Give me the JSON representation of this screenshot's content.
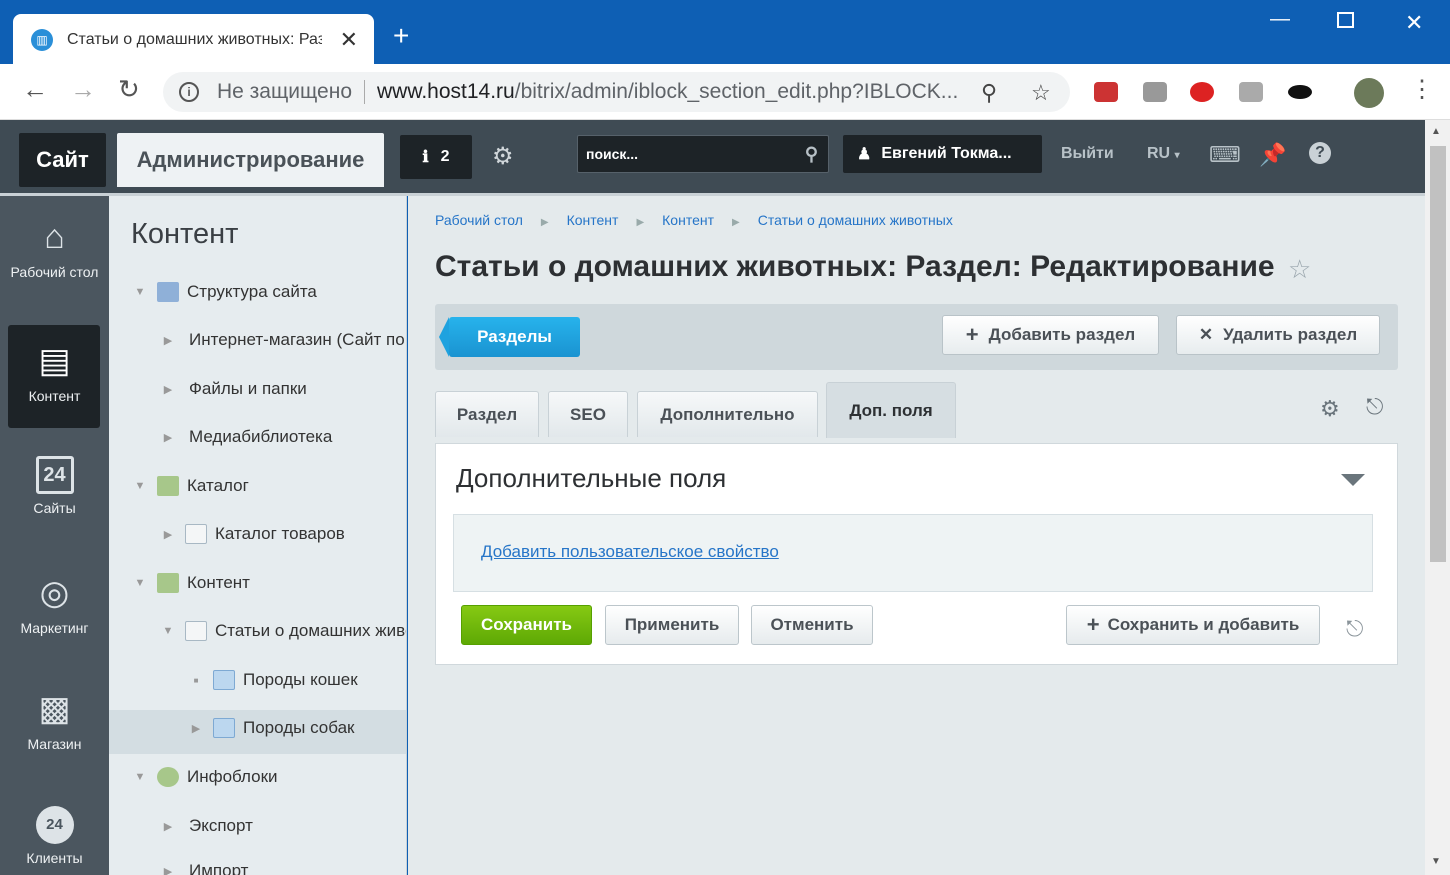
{
  "browser": {
    "tab_title": "Статьи о домашних животных: Раздел: Редактирование",
    "security_label": "Не защищено",
    "url_host": "www.host14.ru",
    "url_path": "/bitrix/admin/iblock_section_edit.php?IBLOCK..."
  },
  "admin_header": {
    "site_button": "Сайт",
    "admin_button": "Администрирование",
    "notifications_count": "2",
    "search_placeholder": "поиск...",
    "user_name": "Евгений Токма...",
    "logout": "Выйти",
    "language": "RU"
  },
  "left_menu": [
    {
      "label": "Рабочий стол",
      "icon": "home-icon"
    },
    {
      "label": "Контент",
      "icon": "document-icon",
      "active": true
    },
    {
      "label": "Сайты",
      "icon": "calendar-icon"
    },
    {
      "label": "Маркетинг",
      "icon": "target-icon"
    },
    {
      "label": "Магазин",
      "icon": "basket-icon"
    },
    {
      "label": "Клиенты",
      "icon": "clients-icon"
    }
  ],
  "tree": {
    "title": "Контент",
    "items": [
      {
        "label": "Структура сайта",
        "icon": "structure-icon"
      },
      {
        "label": "Интернет-магазин (Сайт по умолчанию)"
      },
      {
        "label": "Файлы и папки"
      },
      {
        "label": "Медиабиблиотека"
      },
      {
        "label": "Каталог",
        "icon": "catalog-icon"
      },
      {
        "label": "Каталог товаров",
        "icon": "iblock-icon"
      },
      {
        "label": "Контент",
        "icon": "content-icon"
      },
      {
        "label": "Статьи о домашних животных",
        "icon": "iblock-icon"
      },
      {
        "label": "Породы кошек",
        "icon": "folder-icon"
      },
      {
        "label": "Породы собак",
        "icon": "folder-icon",
        "selected": true
      },
      {
        "label": "Инфоблоки",
        "icon": "infoblocks-icon"
      },
      {
        "label": "Экспорт"
      },
      {
        "label": "Импорт"
      }
    ]
  },
  "breadcrumbs": [
    "Рабочий стол",
    "Контент",
    "Контент",
    "Статьи о домашних животных"
  ],
  "page_title": "Статьи о домашних животных: Раздел: Редактирование",
  "toolbar": {
    "sections_button": "Разделы",
    "add_section": "Добавить раздел",
    "delete_section": "Удалить раздел"
  },
  "form_tabs": [
    "Раздел",
    "SEO",
    "Дополнительно",
    "Доп. поля"
  ],
  "active_tab": "Доп. поля",
  "panel": {
    "title": "Дополнительные поля",
    "add_property_link": "Добавить пользовательское свойство"
  },
  "form_buttons": {
    "save": "Сохранить",
    "apply": "Применить",
    "cancel": "Отменить",
    "save_and_add": "Сохранить и добавить"
  },
  "colors": {
    "browser_blue": "#0e5fb4",
    "admin_dark": "#3f4b54",
    "link_blue": "#2675c8",
    "save_green": "#6db10a",
    "sections_blue": "#1fa2df"
  }
}
